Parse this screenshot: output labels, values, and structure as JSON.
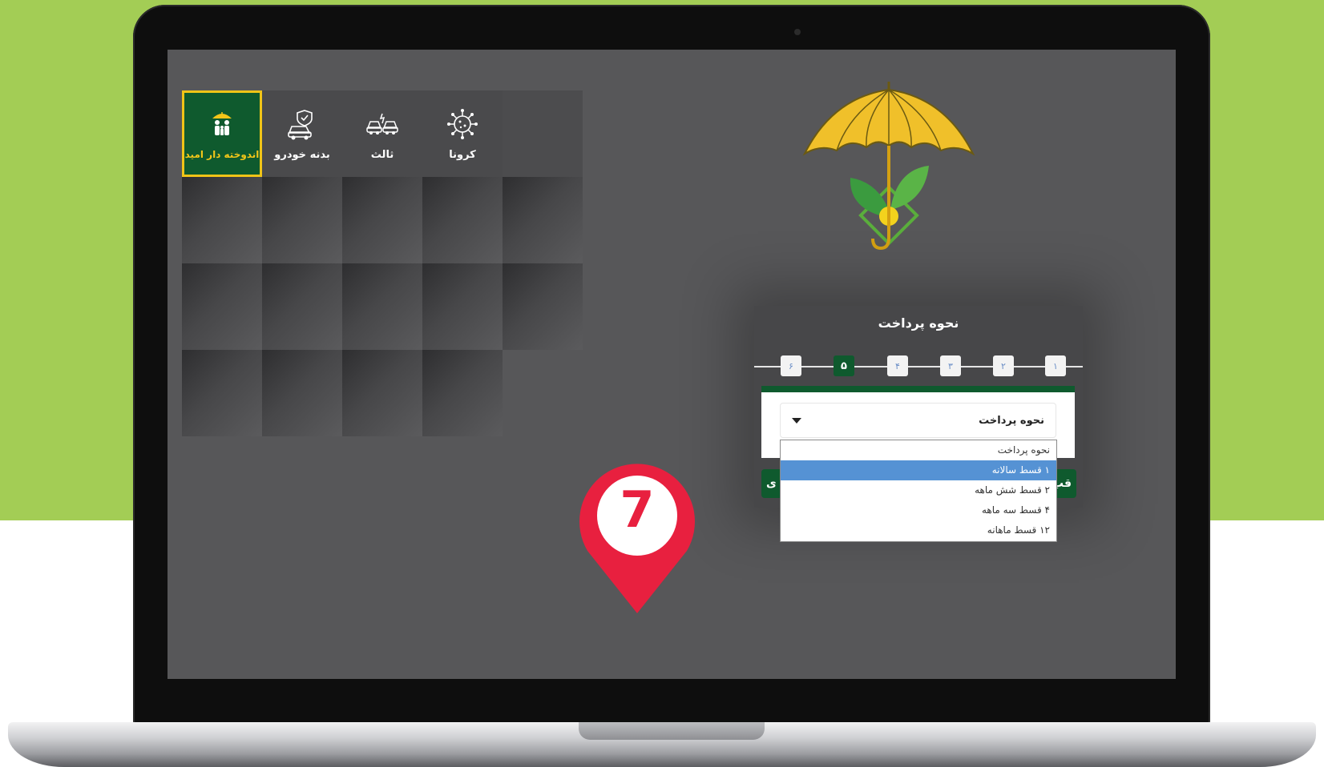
{
  "tiles": [
    {
      "label": "اندوخته دار امید",
      "icon": "family-umbrella-icon",
      "active": true
    },
    {
      "label": "بدنه خودرو",
      "icon": "car-shield-icon",
      "active": false
    },
    {
      "label": "ثالث",
      "icon": "car-crash-icon",
      "active": false
    },
    {
      "label": "کرونا",
      "icon": "virus-icon",
      "active": false
    }
  ],
  "panel": {
    "title": "نحوه پرداخت",
    "steps": [
      "۱",
      "۲",
      "۳",
      "۴",
      "۵",
      "۶"
    ],
    "current_step": "۵",
    "select_value": "نحوه پرداخت",
    "next_label": "ی",
    "prev_label": "قب"
  },
  "dropdown": {
    "options": [
      "نحوه پرداخت",
      "۱ قسط سالانه",
      "۲ قسط شش ماهه",
      "۴ قسط سه ماهه",
      "۱۲ قسط ماهانه"
    ],
    "selected_index": 1
  },
  "marker": {
    "number": "7",
    "color": "#e8203f"
  },
  "colors": {
    "background_green": "#a3cd55",
    "screen_gray": "#575759",
    "brand_green": "#0f5a2e",
    "highlight_yellow": "#f3c619",
    "selection_blue": "#5592d4"
  }
}
